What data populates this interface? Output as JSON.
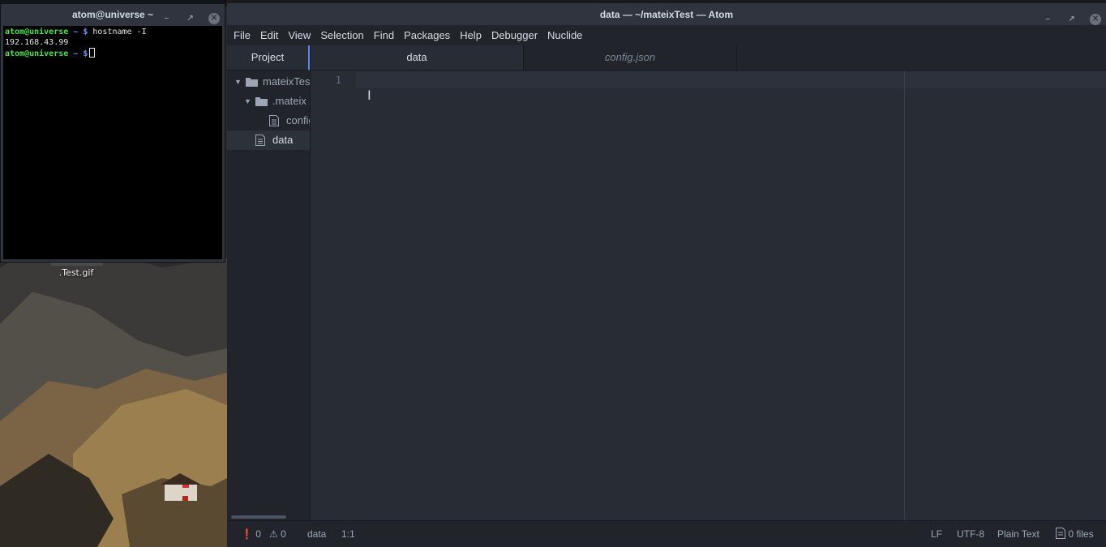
{
  "terminal": {
    "title": "atom@universe ~",
    "lines": [
      {
        "user": "atom@universe",
        "path": " ~ $",
        "command": " hostname -I"
      },
      {
        "output": "192.168.43.99"
      },
      {
        "user": "atom@universe",
        "path": " ~ $",
        "command": ""
      }
    ]
  },
  "desktop": {
    "file_label": ".Test.gif"
  },
  "atom": {
    "title": "data — ~/mateixTest — Atom",
    "menu": [
      "File",
      "Edit",
      "View",
      "Selection",
      "Find",
      "Packages",
      "Help",
      "Debugger",
      "Nuclide"
    ],
    "tree": {
      "tab_label": "Project",
      "items": [
        {
          "label": "mateixTest",
          "type": "folder",
          "expanded": true
        },
        {
          "label": ".mateix",
          "type": "folder",
          "expanded": true
        },
        {
          "label": "config.json",
          "type": "file"
        },
        {
          "label": "data",
          "type": "file",
          "selected": true
        }
      ]
    },
    "tabs": [
      {
        "label": "data",
        "active": true
      },
      {
        "label": "config.json",
        "active": false,
        "preview": true
      }
    ],
    "editor": {
      "line_numbers": [
        "1"
      ]
    },
    "status": {
      "errors": "0",
      "warnings": "0",
      "file": "data",
      "cursor": "1:1",
      "line_ending": "LF",
      "encoding": "UTF-8",
      "grammar": "Plain Text",
      "files": "0 files"
    }
  },
  "colors": {
    "accent": "#568af2",
    "editor_bg": "#282c34",
    "panel_bg": "#21252b",
    "terminal_user": "#4ee24e",
    "terminal_path": "#6a8fff"
  }
}
